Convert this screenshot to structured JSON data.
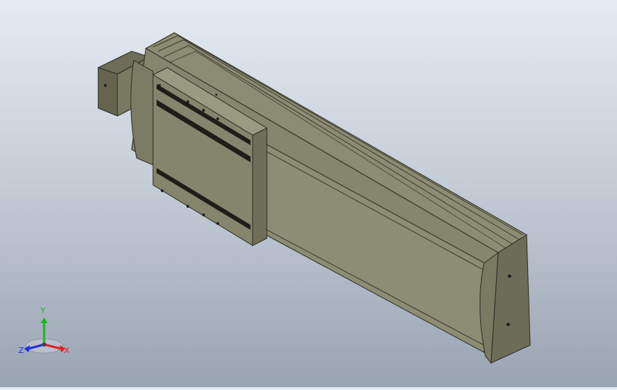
{
  "viewport": {
    "background_top": "#e6ebf1",
    "background_bottom": "#99a4b2",
    "part_color": "#7e7d66"
  },
  "triad": {
    "x_label": "X",
    "y_label": "Y",
    "z_label": "Z",
    "x_color": "#e02020",
    "y_color": "#20b020",
    "z_color": "#2030e0"
  }
}
